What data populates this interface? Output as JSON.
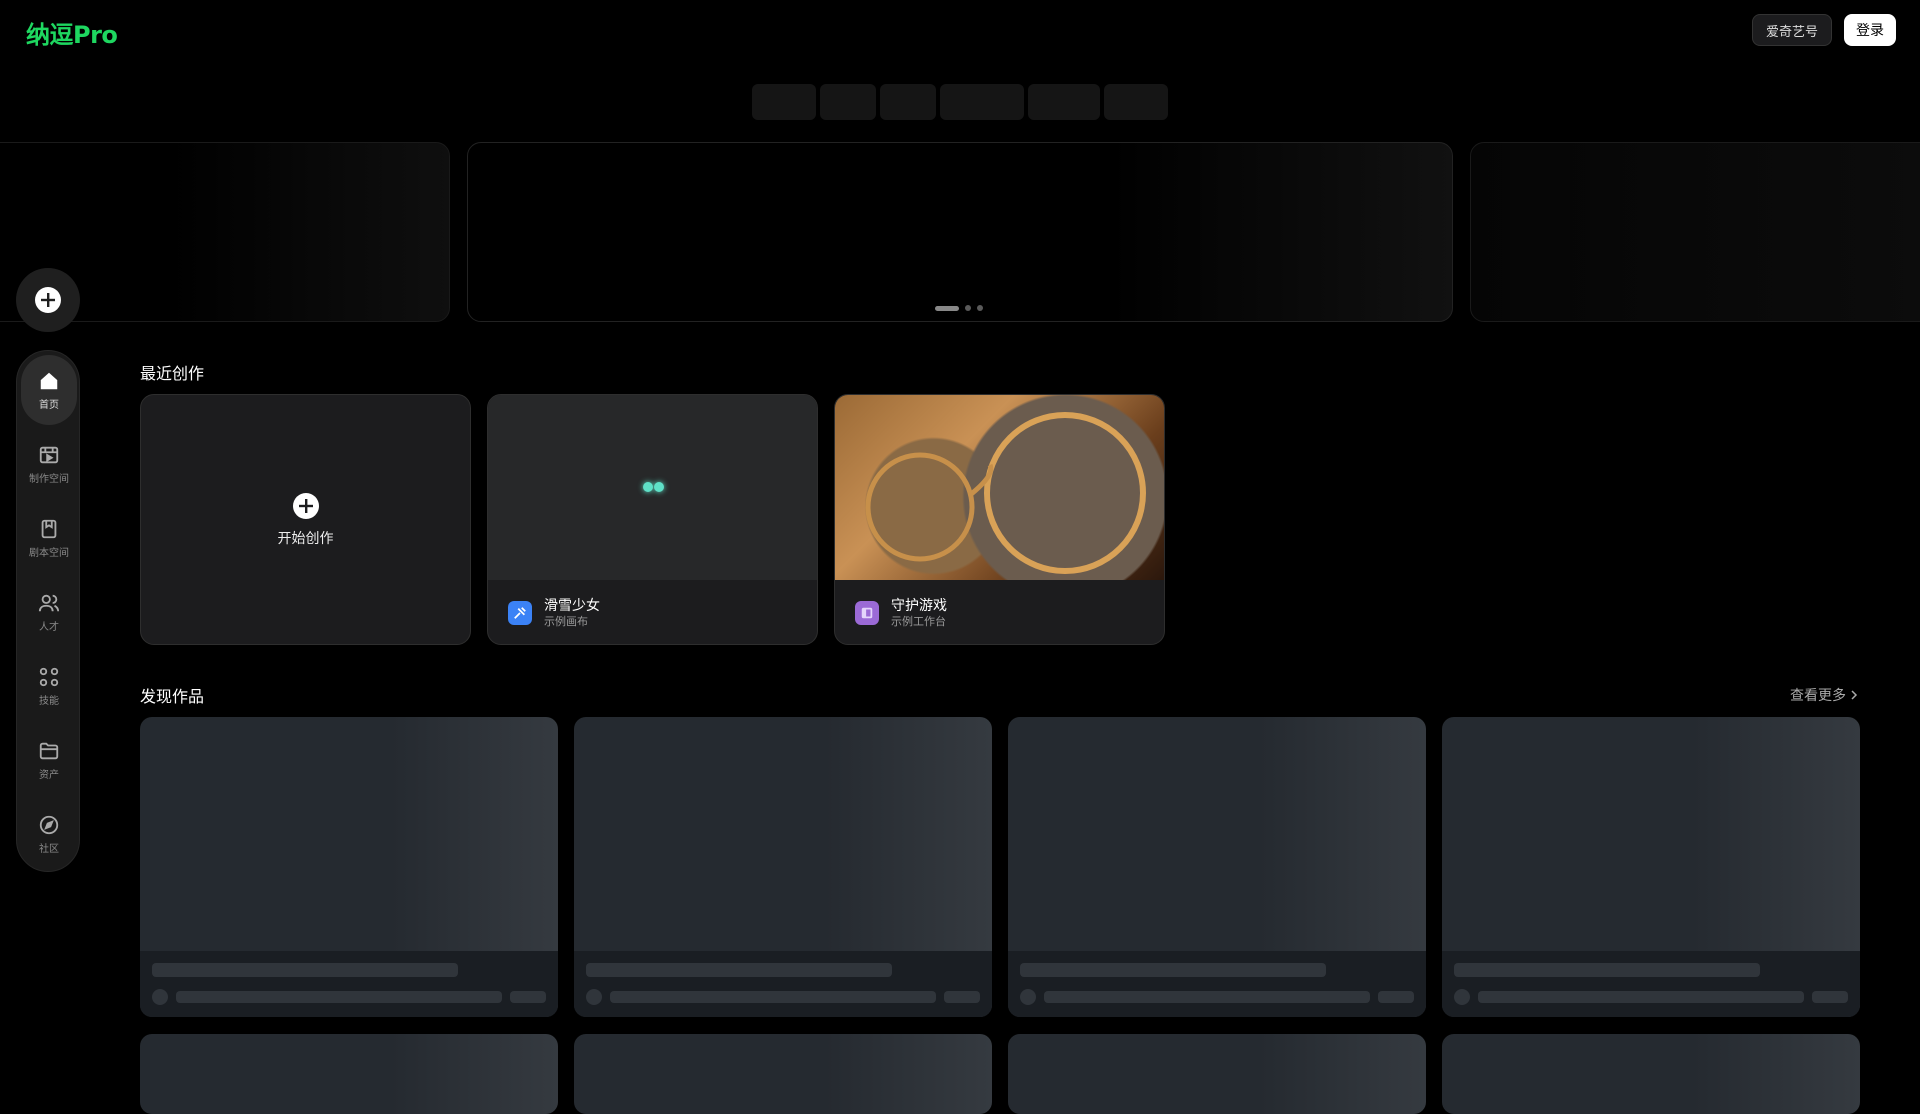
{
  "header": {
    "logo_text": "纳逗Pro",
    "iqiyi_button": "爱奇艺号",
    "login_button": "登录"
  },
  "carousel": {
    "slide_count": 3,
    "active_index": 0
  },
  "sidebar": {
    "items": [
      {
        "label": "首页",
        "icon": "home-icon",
        "active": true
      },
      {
        "label": "制作空间",
        "icon": "production-space-icon",
        "active": false
      },
      {
        "label": "剧本空间",
        "icon": "script-space-icon",
        "active": false
      },
      {
        "label": "人才",
        "icon": "talent-icon",
        "active": false
      },
      {
        "label": "技能",
        "icon": "skills-icon",
        "active": false
      },
      {
        "label": "资产",
        "icon": "folder-icon",
        "active": false
      },
      {
        "label": "社区",
        "icon": "compass-icon",
        "active": false
      }
    ]
  },
  "recent": {
    "title": "最近创作",
    "new_label": "开始创作",
    "cards": [
      {
        "name": "滑雪少女",
        "sub": "示例画布",
        "icon_color": "#3b82f6",
        "status": "loading"
      },
      {
        "name": "守护游戏",
        "sub": "示例工作台",
        "icon_color": "#9b6ad6"
      }
    ]
  },
  "discover": {
    "title": "发现作品",
    "more_link": "查看更多"
  },
  "colors": {
    "brand": "#1ed760",
    "background": "#000000",
    "loader": "#5fe0c7"
  }
}
